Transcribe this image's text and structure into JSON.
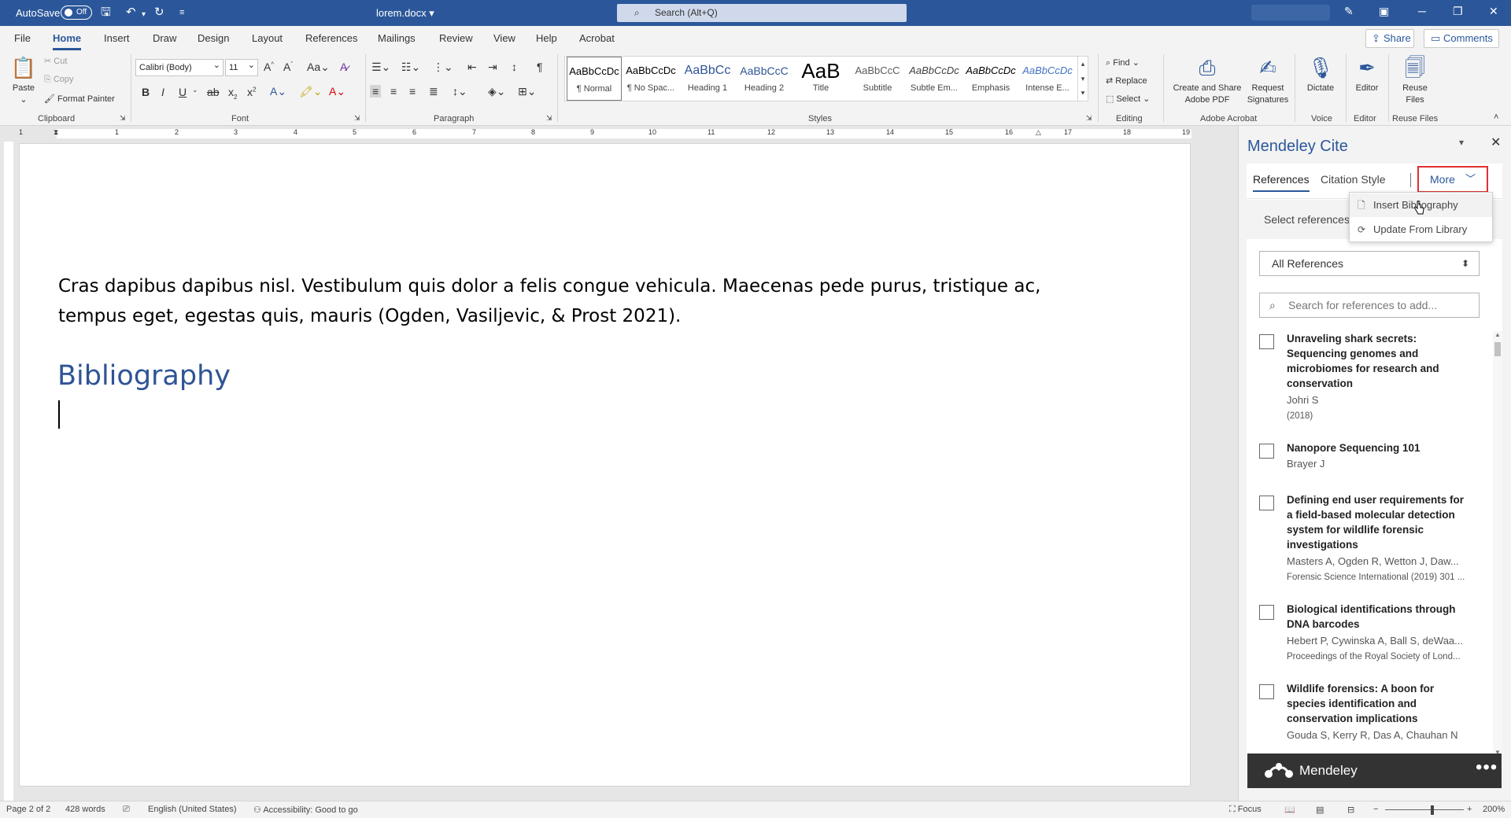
{
  "window": {
    "autosave_label": "AutoSave",
    "autosave_state": "Off",
    "doc_title": "lorem.docx",
    "search_placeholder": "Search (Alt+Q)"
  },
  "menu_tabs": [
    "File",
    "Home",
    "Insert",
    "Draw",
    "Design",
    "Layout",
    "References",
    "Mailings",
    "Review",
    "View",
    "Help",
    "Acrobat"
  ],
  "share_label": "Share",
  "comments_label": "Comments",
  "ribbon": {
    "clipboard": {
      "paste": "Paste",
      "cut": "Cut",
      "copy": "Copy",
      "format_painter": "Format Painter",
      "label": "Clipboard"
    },
    "font": {
      "name": "Calibri (Body)",
      "size": "11",
      "label": "Font"
    },
    "paragraph": {
      "label": "Paragraph"
    },
    "styles": {
      "label": "Styles",
      "items": [
        {
          "preview": "AaBbCcDc",
          "name": "¶ Normal"
        },
        {
          "preview": "AaBbCcDc",
          "name": "¶ No Spac..."
        },
        {
          "preview": "AaBbCc",
          "name": "Heading 1"
        },
        {
          "preview": "AaBbCcC",
          "name": "Heading 2"
        },
        {
          "preview": "AaB",
          "name": "Title"
        },
        {
          "preview": "AaBbCcC",
          "name": "Subtitle"
        },
        {
          "preview": "AaBbCcDc",
          "name": "Subtle Em..."
        },
        {
          "preview": "AaBbCcDc",
          "name": "Emphasis"
        },
        {
          "preview": "AaBbCcDc",
          "name": "Intense E..."
        }
      ]
    },
    "editing": {
      "find": "Find",
      "replace": "Replace",
      "select": "Select",
      "label": "Editing"
    },
    "acrobat": {
      "create_share": "Create and Share Adobe PDF",
      "request_signatures": "Request Signatures",
      "label": "Adobe Acrobat"
    },
    "voice": {
      "dictate": "Dictate",
      "label": "Voice"
    },
    "editor": {
      "editor": "Editor",
      "label": "Editor"
    },
    "reuse": {
      "reuse_files": "Reuse Files",
      "label": "Reuse Files"
    }
  },
  "ruler_numbers": [
    "1",
    "1",
    "2",
    "3",
    "4",
    "5",
    "6",
    "7",
    "8",
    "9",
    "10",
    "11",
    "12",
    "13",
    "14",
    "15",
    "16",
    "17",
    "18",
    "19"
  ],
  "document": {
    "body_text": "Cras dapibus dapibus nisl. Vestibulum quis dolor a felis congue vehicula. Maecenas pede purus, tristique ac, tempus eget, egestas quis, mauris (Ogden, Vasiljevic, & Prost 2021).",
    "heading": "Bibliography"
  },
  "mendeley": {
    "title": "Mendeley Cite",
    "tabs": {
      "references": "References",
      "citation_style": "Citation Style",
      "more": "More"
    },
    "select_refs_text": "Select references",
    "dropdown": {
      "insert_bibliography": "Insert Bibliography",
      "update_from_library": "Update From Library"
    },
    "filter": "All References",
    "search_placeholder": "Search for references to add...",
    "references": [
      {
        "title": "Unraveling shark secrets: Sequencing genomes and microbiomes for research and conservation",
        "authors": "Johri S",
        "meta": "(2018)"
      },
      {
        "title": "Nanopore Sequencing 101",
        "authors": "Brayer J",
        "meta": ""
      },
      {
        "title": "Defining end user requirements for a field-based molecular detection system for wildlife forensic investigations",
        "authors": "Masters A, Ogden R, Wetton J, Daw...",
        "meta": "Forensic Science International (2019) 301 ..."
      },
      {
        "title": "Biological identifications through DNA barcodes",
        "authors": "Hebert P, Cywinska A, Ball S, deWaa...",
        "meta": "Proceedings of the Royal Society of Lond..."
      },
      {
        "title": "Wildlife forensics: A boon for species identification and conservation implications",
        "authors": "Gouda S, Kerry R, Das A, Chauhan N",
        "meta": ""
      }
    ],
    "footer_brand": "Mendeley"
  },
  "statusbar": {
    "page": "Page 2 of 2",
    "words": "428 words",
    "language": "English (United States)",
    "accessibility": "Accessibility: Good to go",
    "focus": "Focus",
    "zoom": "200%"
  }
}
